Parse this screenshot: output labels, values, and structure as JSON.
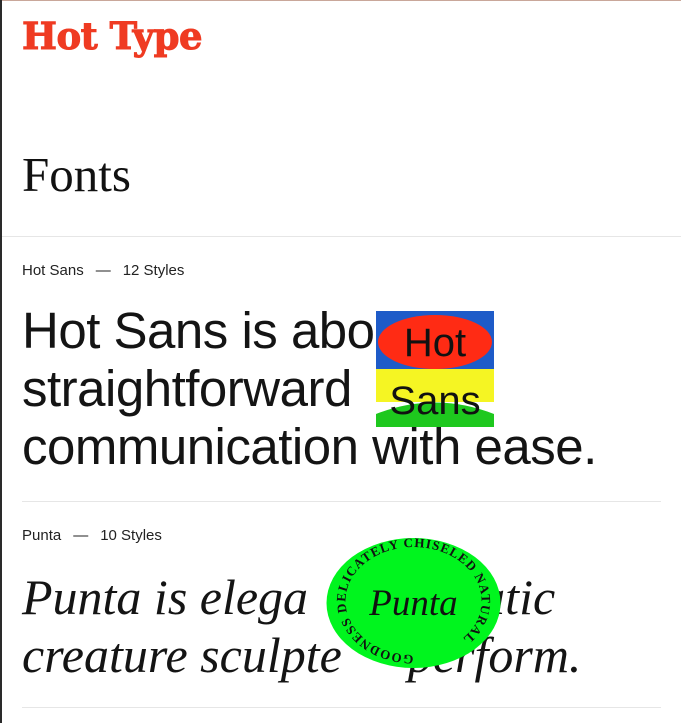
{
  "header": {
    "logo": "Hot Type"
  },
  "page": {
    "title": "Fonts"
  },
  "fonts": [
    {
      "name": "Hot Sans",
      "separator": "—",
      "styles": "12 Styles",
      "specimen_lines": [
        "Hot Sans is abo",
        "straightforward",
        "communication with ease."
      ],
      "badge": {
        "words": [
          "Hot",
          "Sans"
        ],
        "colors": {
          "blue": "#1e5bc8",
          "red": "#ff2b14",
          "yellow": "#f5f523",
          "green": "#1ec81e"
        }
      }
    },
    {
      "name": "Punta",
      "separator": "—",
      "styles": "10 Styles",
      "specimen_lines": [
        "Punta is elega",
        "matic",
        "creature sculpte",
        "perform."
      ],
      "badge": {
        "center": "Punta",
        "ring_text": "GOODNESS DELICATELY CHISELED NATURAL",
        "color": "#00f51e"
      }
    }
  ],
  "colors": {
    "brand": "#ef3b22",
    "text": "#111111",
    "divider": "#e6e6e6"
  }
}
